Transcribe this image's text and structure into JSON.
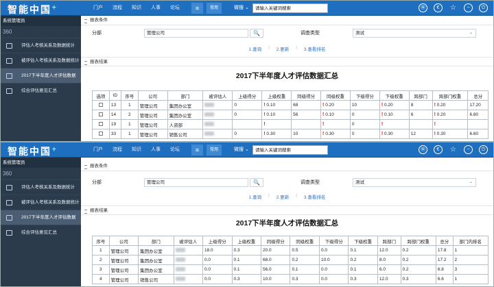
{
  "app": {
    "logo": "智能中国",
    "logo_mark": "+",
    "nav": [
      "门户",
      "流程",
      "知识",
      "人事",
      "论坛"
    ],
    "menu_glyph": "≡",
    "common_label": "常用",
    "search_type": "微搜",
    "search_placeholder": "请输入关键词搜索",
    "top_icons": [
      {
        "name": "M-icon",
        "glyph": "Ⓜ"
      },
      {
        "name": "euro-icon",
        "glyph": "€"
      },
      {
        "name": "star-icon",
        "glyph": "☆"
      },
      {
        "name": "minus-icon",
        "glyph": "−"
      },
      {
        "name": "power-icon",
        "glyph": "⏻"
      }
    ]
  },
  "sidebar": {
    "user": "系统管理员",
    "number": "360",
    "items": [
      {
        "label": "评估人考核关系及数据统计"
      },
      {
        "label": "被评估人考核关系及数据统计"
      },
      {
        "label": "2017下半年度人才评估数据",
        "active": true
      },
      {
        "label": "综合评估意见汇总"
      }
    ]
  },
  "filter": {
    "section_title": "报表条件",
    "dept_label": "分部",
    "dept_value": "管理公司",
    "search_btn": "🔍",
    "type_label": "调查类型",
    "type_value": "测试",
    "links": [
      "1.查询",
      "2.更新",
      "3.查看排名"
    ],
    "sep": "|"
  },
  "results": {
    "section_title": "报表结果",
    "title": "2017下半年度人才评估数据汇总"
  },
  "table1": {
    "headers": [
      "选项",
      "ID",
      "序号",
      "公司",
      "部门",
      "被评估人",
      "上级得分",
      "上级权重",
      "同级得分",
      "同级权重",
      "下级得分",
      "下级权重",
      "跨部门",
      "跨部门权重",
      "总分"
    ],
    "rows": [
      {
        "id": "13",
        "seq": "1",
        "company": "管理公司",
        "dept": "集团办公室",
        "sup_score": "0",
        "sup_w": "0.10",
        "peer_score": "68",
        "peer_w": "0.20",
        "sub_score": "10",
        "sub_w": "0.20",
        "cross": "8",
        "cross_w": "0.20",
        "total": "17.20"
      },
      {
        "id": "14",
        "seq": "2",
        "company": "管理公司",
        "dept": "集团办公室",
        "sup_score": "0",
        "sup_w": "0.10",
        "peer_score": "56",
        "peer_w": "0.10",
        "sub_score": "0",
        "sub_w": "0.10",
        "cross": "6",
        "cross_w": "0.20",
        "total": "6.80"
      },
      {
        "id": "19",
        "seq": "1",
        "company": "管理公司",
        "dept": "人资部",
        "sup_score": "",
        "sup_w": "",
        "peer_score": "",
        "peer_w": "",
        "sub_score": "0",
        "sub_w": "",
        "cross": "",
        "cross_w": "",
        "total": ""
      },
      {
        "id": "33",
        "seq": "1",
        "company": "管理公司",
        "dept": "销售公司",
        "sup_score": "0",
        "sup_w": "0.30",
        "peer_score": "10",
        "peer_w": "0.30",
        "sub_score": "0",
        "sub_w": "0.30",
        "cross": "12",
        "cross_w": "0.30",
        "total": "6.60"
      }
    ]
  },
  "table2": {
    "headers": [
      "序号",
      "公司",
      "部门",
      "被评估人",
      "上级得分",
      "上级权重",
      "同级得分",
      "同级权重",
      "下级得分",
      "下级权重",
      "跨部门",
      "跨部门权重",
      "总分",
      "部门内排名"
    ],
    "rows": [
      {
        "seq": "1",
        "company": "管理公司",
        "dept": "集团办公室",
        "sup_score": "18.0",
        "sup_w": "0.3",
        "peer_score": "20.0",
        "peer_w": "0.5",
        "sub_score": "0.0",
        "sub_w": "0.1",
        "cross": "12.0",
        "cross_w": "0.2",
        "total": "17.8",
        "rank": "1"
      },
      {
        "seq": "2",
        "company": "管理公司",
        "dept": "集团办公室",
        "sup_score": "0.0",
        "sup_w": "0.1",
        "peer_score": "68.0",
        "peer_w": "0.2",
        "sub_score": "10.0",
        "sub_w": "0.2",
        "cross": "8.0",
        "cross_w": "0.2",
        "total": "17.2",
        "rank": "2"
      },
      {
        "seq": "3",
        "company": "管理公司",
        "dept": "集团办公室",
        "sup_score": "0.0",
        "sup_w": "0.1",
        "peer_score": "56.0",
        "peer_w": "0.1",
        "sub_score": "0.0",
        "sub_w": "0.1",
        "cross": "6.0",
        "cross_w": "0.2",
        "total": "6.8",
        "rank": "3"
      },
      {
        "seq": "4",
        "company": "管理公司",
        "dept": "销售公司",
        "sup_score": "0.0",
        "sup_w": "0.3",
        "peer_score": "10.0",
        "peer_w": "0.3",
        "sub_score": "0.0",
        "sub_w": "0.3",
        "cross": "12.0",
        "cross_w": "0.3",
        "total": "6.6",
        "rank": "1"
      }
    ]
  },
  "warn_mark": "!"
}
